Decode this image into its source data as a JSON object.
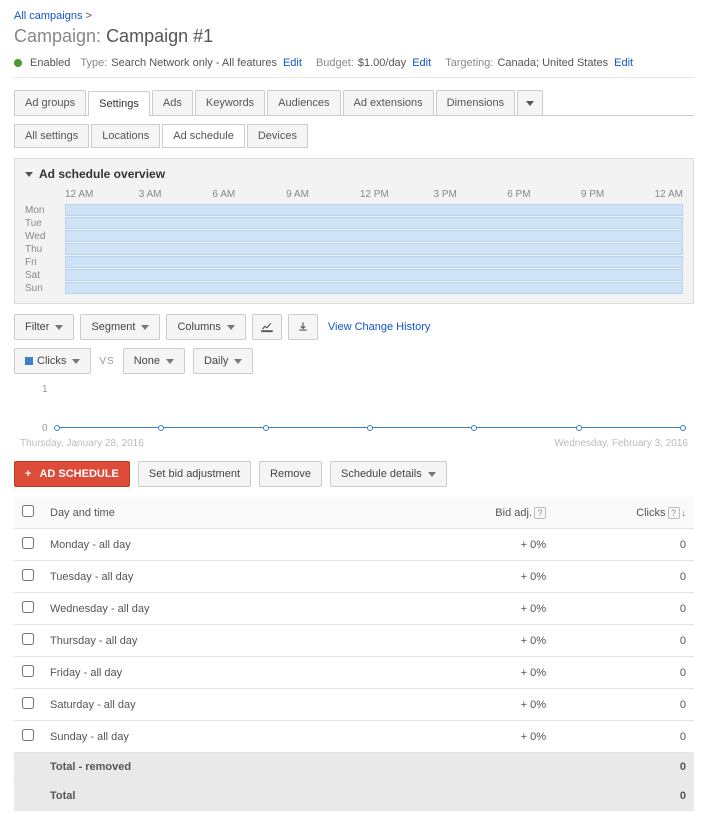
{
  "breadcrumb": {
    "all": "All campaigns",
    "sep": ">"
  },
  "title": {
    "label": "Campaign:",
    "name": "Campaign #1"
  },
  "status": {
    "enabled": "Enabled",
    "type_label": "Type:",
    "type_value": "Search Network only - All features",
    "budget_label": "Budget:",
    "budget_value": "$1.00/day",
    "targeting_label": "Targeting:",
    "targeting_value": "Canada; United States",
    "edit": "Edit"
  },
  "tabs": [
    "Ad groups",
    "Settings",
    "Ads",
    "Keywords",
    "Audiences",
    "Ad extensions",
    "Dimensions"
  ],
  "active_tab": 1,
  "subtabs": [
    "All settings",
    "Locations",
    "Ad schedule",
    "Devices"
  ],
  "active_subtab": 2,
  "panel_title": "Ad schedule overview",
  "time_labels": [
    "12 AM",
    "3 AM",
    "6 AM",
    "9 AM",
    "12 PM",
    "3 PM",
    "6 PM",
    "9 PM",
    "12 AM"
  ],
  "days": [
    "Mon",
    "Tue",
    "Wed",
    "Thu",
    "Fri",
    "Sat",
    "Sun"
  ],
  "toolbar": {
    "filter": "Filter",
    "segment": "Segment",
    "columns": "Columns",
    "history": "View Change History"
  },
  "metrics": {
    "clicks": "Clicks",
    "vs": "VS",
    "none": "None",
    "daily": "Daily"
  },
  "chart_data": {
    "type": "line",
    "series_name": "Clicks",
    "y_values": [
      0,
      0,
      0,
      0,
      0,
      0,
      0
    ],
    "ylim": [
      0,
      1
    ],
    "date_start": "Thursday, January 28, 2016",
    "date_end": "Wednesday, February 3, 2016"
  },
  "actions": {
    "add": "AD SCHEDULE",
    "bid": "Set bid adjustment",
    "remove": "Remove",
    "details": "Schedule details"
  },
  "table": {
    "columns": {
      "daytime": "Day and time",
      "bid": "Bid adj.",
      "clicks": "Clicks"
    },
    "rows": [
      {
        "day": "Monday - all day",
        "bid": "+ 0%",
        "clicks": "0"
      },
      {
        "day": "Tuesday - all day",
        "bid": "+ 0%",
        "clicks": "0"
      },
      {
        "day": "Wednesday - all day",
        "bid": "+ 0%",
        "clicks": "0"
      },
      {
        "day": "Thursday - all day",
        "bid": "+ 0%",
        "clicks": "0"
      },
      {
        "day": "Friday - all day",
        "bid": "+ 0%",
        "clicks": "0"
      },
      {
        "day": "Saturday - all day",
        "bid": "+ 0%",
        "clicks": "0"
      },
      {
        "day": "Sunday - all day",
        "bid": "+ 0%",
        "clicks": "0"
      }
    ],
    "total_removed_label": "Total - removed",
    "total_removed_value": "0",
    "total_label": "Total",
    "total_value": "0"
  }
}
